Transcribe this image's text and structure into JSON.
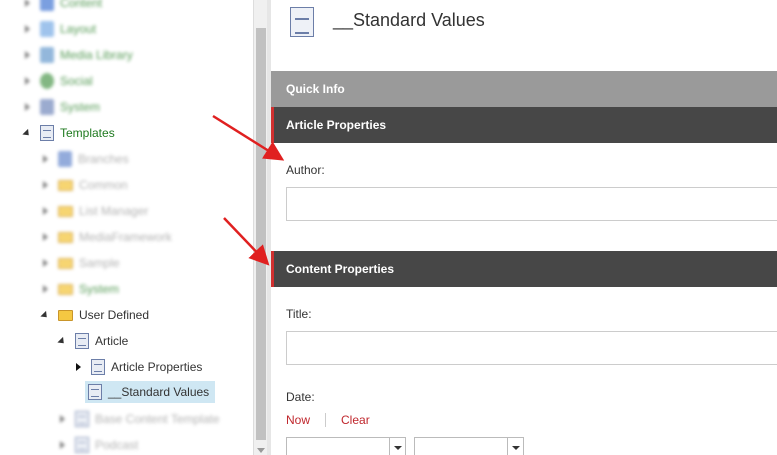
{
  "tree": {
    "rows": [
      {
        "label": "Content",
        "style": "blurred green"
      },
      {
        "label": "Layout",
        "style": "blurred green"
      },
      {
        "label": "Media Library",
        "style": "blurred green"
      },
      {
        "label": "Social",
        "style": "blurred green"
      },
      {
        "label": "System",
        "style": "blurred green"
      },
      {
        "label": "Templates",
        "style": "green"
      },
      {
        "label": "Branches",
        "style": "blurred gray"
      },
      {
        "label": "Common",
        "style": "blurred gray"
      },
      {
        "label": "List Manager",
        "style": "blurred gray"
      },
      {
        "label": "MediaFramework",
        "style": "blurred gray"
      },
      {
        "label": "Sample",
        "style": "blurred gray"
      },
      {
        "label": "System",
        "style": "blurred green"
      },
      {
        "label": "User Defined",
        "style": "normal"
      },
      {
        "label": "Article",
        "style": "normal"
      },
      {
        "label": "Article Properties",
        "style": "normal"
      },
      {
        "label": "__Standard Values",
        "style": "selected"
      },
      {
        "label": "Base Content Template",
        "style": "blurred gray"
      },
      {
        "label": "Podcast",
        "style": "blurred gray"
      }
    ]
  },
  "header": {
    "title": "__Standard Values",
    "icon": "document-icon"
  },
  "sections": {
    "quick_info": "Quick Info",
    "article_properties": "Article Properties",
    "content_properties": "Content Properties"
  },
  "fields": {
    "author_label": "Author:",
    "author_value": "",
    "title_label": "Title:",
    "title_value": "",
    "date_label": "Date:",
    "date_now": "Now",
    "date_clear": "Clear"
  },
  "colors": {
    "accent_red": "#d03030",
    "section_bar": "#474747",
    "quick_info_bar": "#9a9a9a",
    "tree_green": "#1f7a1f",
    "selection": "#cfe7f3",
    "arrow_red": "#e02020"
  }
}
